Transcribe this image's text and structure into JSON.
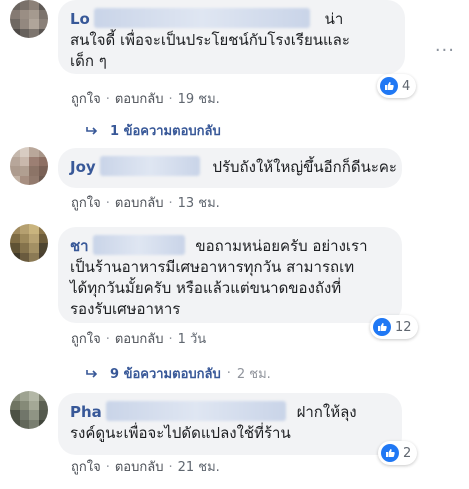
{
  "comments": [
    {
      "author": "Lo",
      "text": "น่าสนใจดี้ เพื่อจะเป็นประโยชน์กับโรงเรียนและเด็ก ๆ",
      "line1_tail": "น่า",
      "line2": "สนใจดี้ เพื่อจะเป็นประโยชน์กับโรงเรียนและ",
      "line3": "เด็ก ๆ",
      "like_label": "ถูกใจ",
      "reply_label": "ตอบกลับ",
      "time": "19 ชม.",
      "reaction_count": "4",
      "replies_label": "1 ข้อความตอบกลับ",
      "avatar_colors": [
        "#6b6560",
        "#7a716a",
        "#8c8178",
        "#5e5955",
        "#857a72",
        "#9a8e84",
        "#a59a8f",
        "#7c736c",
        "#6f6862",
        "#93887f",
        "#b0a59a",
        "#8a8078",
        "#4f4b48",
        "#67615c",
        "#7d756e",
        "#595450"
      ]
    },
    {
      "author": "Joy",
      "text": "ปรับถังให้ใหญ่ขึ้นอีกก็ดีนะคะ",
      "like_label": "ถูกใจ",
      "reply_label": "ตอบกลับ",
      "time": "13 ชม.",
      "avatar_colors": [
        "#c5b8ad",
        "#d8ccc2",
        "#b9a79a",
        "#a89588",
        "#b7a69a",
        "#c9b8ac",
        "#9c7f73",
        "#8d6f63",
        "#ad9b8e",
        "#b19f91",
        "#8c7467",
        "#7a6156",
        "#c2b2a5",
        "#a78f81",
        "#927a6d",
        "#6e5a50"
      ]
    },
    {
      "author": "ชา",
      "text": "ขอถามหน่อยครับ อย่างเราเป็นร้านอาหารมีเศษอาหารทุกวัน สามารถเทได้ทุกวันมั้ยครับ หรือแล้วแต่ขนาดของถังที่รองรับเศษอาหาร",
      "line1_tail": "ขอถามหน่อยครับ อย่างเรา",
      "line2": "เป็นร้านอาหารมีเศษอาหารทุกวัน สามารถเท",
      "line3": "ได้ทุกวันมั้ยครับ หรือแล้วแต่ขนาดของถังที่",
      "line4": "รองรับเศษอาหาร",
      "like_label": "ถูกใจ",
      "reply_label": "ตอบกลับ",
      "time": "1 วัน",
      "reaction_count": "12",
      "replies_label": "9 ข้อความตอบกลับ",
      "replies_time": "2 ชม.",
      "avatar_colors": [
        "#a08a5e",
        "#b5a070",
        "#c9b47e",
        "#8a7448",
        "#7f6c44",
        "#9e8a5c",
        "#b8a373",
        "#6d5c3a",
        "#5f5234",
        "#85734c",
        "#a39064",
        "#4d4430",
        "#3f3828",
        "#6a5b3e",
        "#8b7a55",
        "#4a4030"
      ]
    },
    {
      "author": "Pha",
      "text": "ฝากให้ลุงรงค์ดูนะเพื่อจะไปดัดแปลงใช้ที่ร้าน",
      "line1_tail": "ฝากให้ลุง",
      "line2": "รงค์ดูนะเพื่อจะไปดัดแปลงใช้ที่ร้าน",
      "like_label": "ถูกใจ",
      "reply_label": "ตอบกลับ",
      "time": "21 ชม.",
      "reaction_count": "2",
      "avatar_colors": [
        "#8a8f7e",
        "#9ea391",
        "#b3b7a6",
        "#7c806f",
        "#6f7462",
        "#858a78",
        "#a4a896",
        "#5c6052",
        "#4d5145",
        "#71766a",
        "#8f9484",
        "#555a4e",
        "#4a4f43",
        "#62675a",
        "#797e70",
        "#42463c"
      ]
    }
  ],
  "colors": {
    "link": "#385898",
    "bubble": "#f2f3f5",
    "like_blue": "#2078f4",
    "meta": "#606770"
  },
  "icons": {
    "more": "more-options-icon",
    "like": "thumbs-up-icon",
    "reply_arrow": "reply-arrow-icon"
  }
}
